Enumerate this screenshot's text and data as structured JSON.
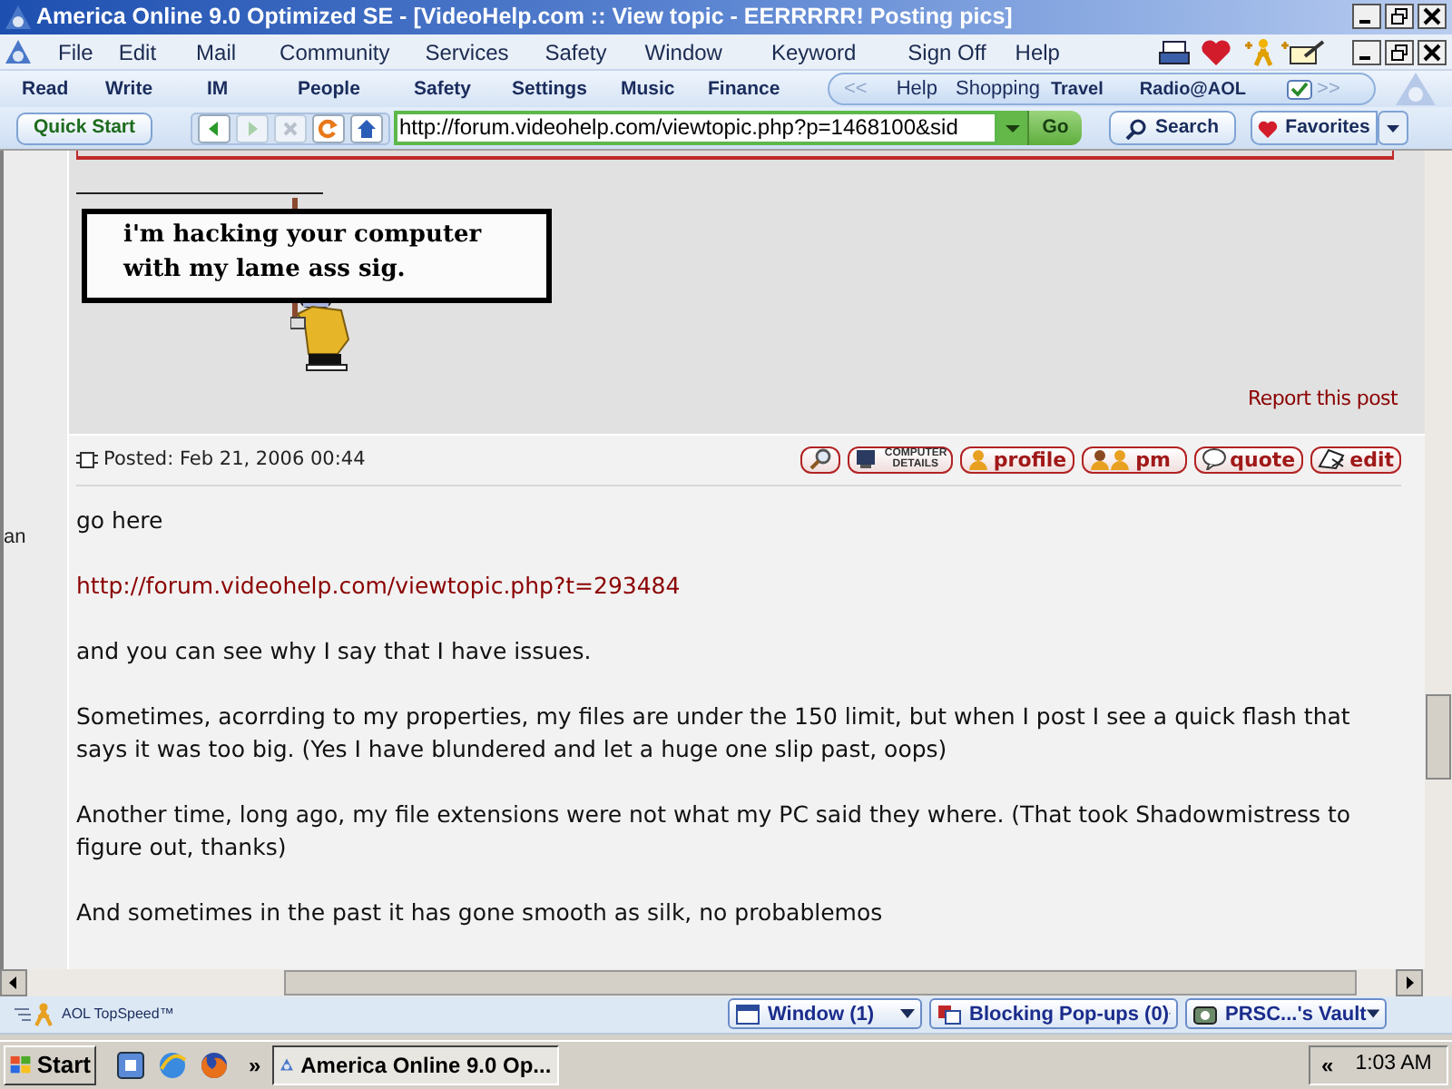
{
  "window": {
    "title": "America Online 9.0 Optimized SE - [VideoHelp.com :: View topic - EERRRRR! Posting pics]"
  },
  "menu": [
    "File",
    "Edit",
    "Mail",
    "Community",
    "Services",
    "Safety",
    "Window",
    "Keyword",
    "Sign Off",
    "Help"
  ],
  "aol_toolbar": [
    "Read",
    "Write",
    "IM",
    "People",
    "Safety",
    "Settings",
    "Music",
    "Finance"
  ],
  "channels": {
    "back": "<<",
    "items": [
      "Help",
      "Shopping",
      "Travel",
      "Radio@AOL"
    ],
    "forward": ">>"
  },
  "navigation": {
    "quick_start": "Quick Start",
    "url": "http://forum.videohelp.com/viewtopic.php?p=1468100&sid",
    "go": "Go",
    "search": "Search",
    "favorites": "Favorites"
  },
  "sidebar_fragment": "an",
  "signature": {
    "lines": [
      "i'm hacking your computer",
      "with my lame ass sig."
    ]
  },
  "report_link": "Report this post",
  "post": {
    "posted": "Posted: Feb 21, 2006 00:44",
    "buttons": [
      {
        "kind": "search"
      },
      {
        "kind": "details",
        "label": "COMPUTER DETAILS"
      },
      {
        "kind": "profile",
        "label": "profile"
      },
      {
        "kind": "pm",
        "label": "pm"
      },
      {
        "kind": "quote",
        "label": "quote"
      },
      {
        "kind": "edit",
        "label": "edit"
      }
    ],
    "paragraphs": [
      {
        "kind": "text",
        "text": "go here"
      },
      {
        "kind": "link",
        "text": "http://forum.videohelp.com/viewtopic.php?t=293484"
      },
      {
        "kind": "text",
        "text": "and you can see why I say that I have issues."
      },
      {
        "kind": "text",
        "text": "Sometimes, acorrding to my properties, my files are under the 150 limit, but when I post I see a quick flash that says it was too big. (Yes I have blundered and let a huge one slip past, oops)"
      },
      {
        "kind": "text",
        "text": "Another time, long ago, my file extensions were not what my PC said they where. (That took Shadowmistress to figure out, thanks)"
      },
      {
        "kind": "text",
        "text": "And sometimes in the past it has gone smooth as silk, no probablemos"
      }
    ]
  },
  "status_bar": {
    "topspeed": "AOL TopSpeed™",
    "buttons": [
      "Window (1)",
      "Blocking Pop-ups (0)",
      "PRSC...'s Vault"
    ]
  },
  "taskbar": {
    "start": "Start",
    "chevron": "»",
    "task": "America Online 9.0 Op...",
    "tray_chevron": "«",
    "clock": "1:03 AM"
  }
}
